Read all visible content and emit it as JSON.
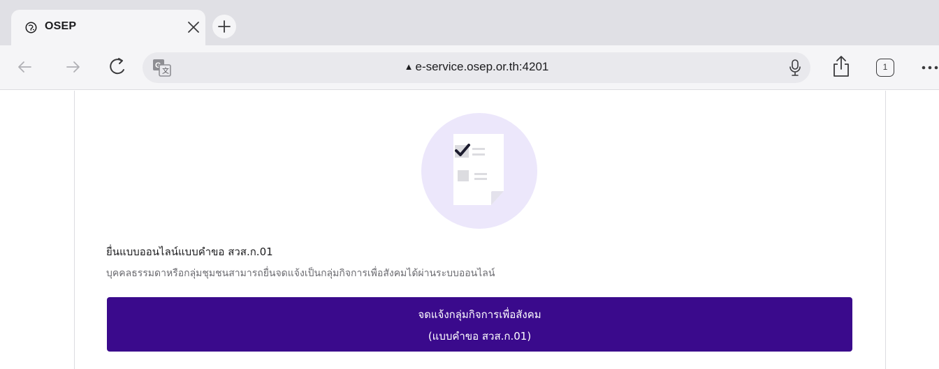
{
  "browser": {
    "tab": {
      "title": "OSEP",
      "favicon": "globe-icon"
    },
    "new_tab_icon": "plus-icon",
    "address": {
      "url": "e-service.osep.or.th:4201",
      "lock_glyph": "▲"
    },
    "tab_count": "1",
    "icons": {
      "back": "arrow-left-icon",
      "forward": "arrow-right-icon",
      "reload": "reload-icon",
      "translate": "translate-icon",
      "mic": "microphone-icon",
      "share": "share-icon",
      "tabs": "tabs-icon",
      "more": "more-icon"
    }
  },
  "page": {
    "illustration": "document-checklist-icon",
    "heading": "ยื่นแบบออนไลน์แบบคำขอ สวส.ก.01",
    "subtext": "บุคคลธรรมดาหรือกลุ่มชุมชนสามารถยื่นจดแจ้งเป็นกลุ่มกิจการเพื่อสังคมได้ผ่านระบบออนไลน์",
    "cta": {
      "line1": "จดแจ้งกลุ่มกิจการเพื่อสังคม",
      "line2": "(แบบคำขอ สวส.ก.01)"
    }
  },
  "colors": {
    "accent": "#3a0a8c",
    "illustration_bg": "#ece7fb"
  }
}
